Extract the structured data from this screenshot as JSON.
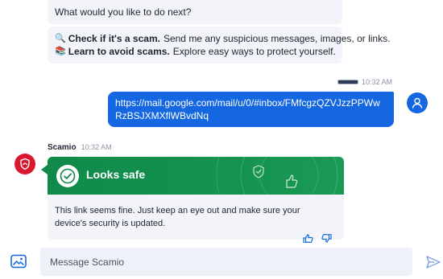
{
  "chat": {
    "bot_prompt": "What would you like to do next?",
    "options": [
      {
        "icon": "magnifier-icon",
        "emoji": "🔍",
        "bold": "Check if it's a scam.",
        "text": "Send me any suspicious messages, images, or links."
      },
      {
        "icon": "books-icon",
        "emoji": "📚",
        "bold": "Learn to avoid scams.",
        "text": "Explore easy ways to protect yourself."
      }
    ],
    "user_message": {
      "time": "10:32 AM",
      "text": "https://mail.google.com/mail/u/0/#inbox/FMfcgzQZVJzzPPWwRzBSJXMXflWBvdNq"
    },
    "bot_reply": {
      "name": "Scamio",
      "time": "10:32 AM",
      "verdict": "Looks safe",
      "verdict_color": "#0f8a4a",
      "text": "This link seems fine. Just keep an eye out and make sure your device's security is updated."
    }
  },
  "composer": {
    "placeholder": "Message Scamio"
  },
  "colors": {
    "accent": "#1467e0",
    "brand_red": "#d9182d",
    "bubble_bg": "#f2f4fa"
  }
}
